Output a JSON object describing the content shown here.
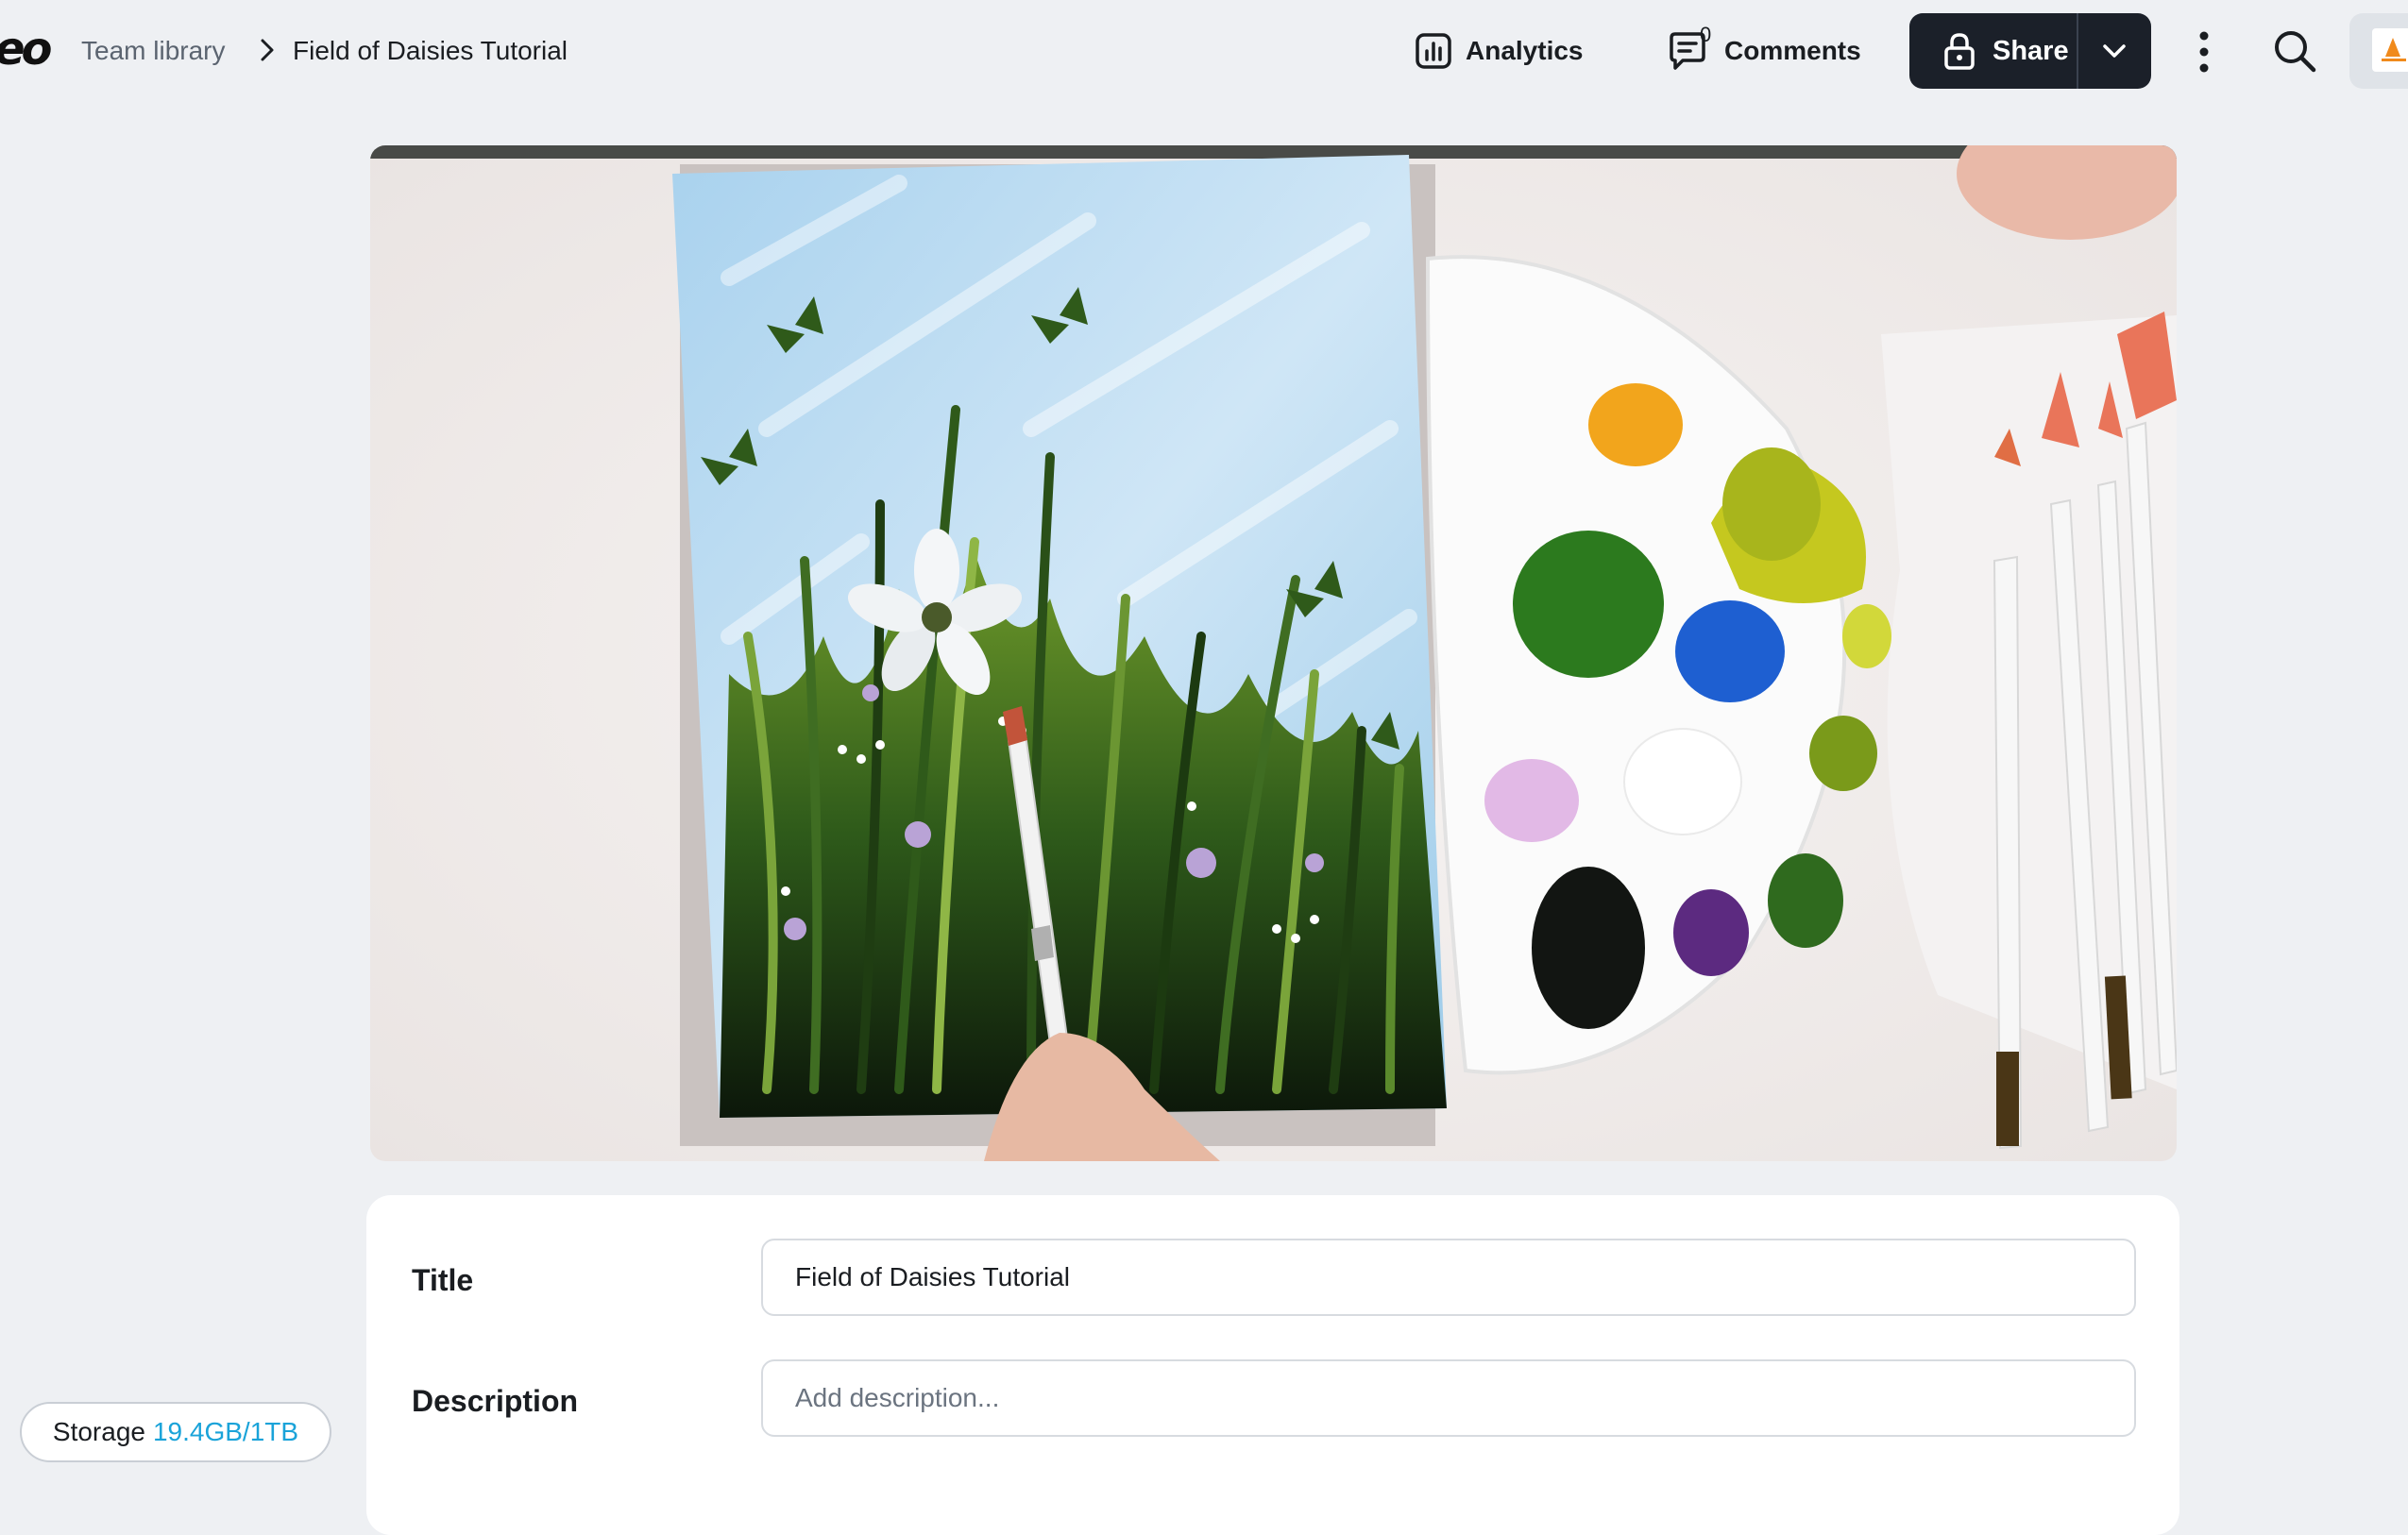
{
  "header": {
    "logo_text": "eo",
    "breadcrumb": {
      "parent": "Team library",
      "current": "Field of Daisies Tutorial"
    },
    "analytics_label": "Analytics",
    "comments_label": "Comments",
    "comments_count": "0",
    "share_label": "Share"
  },
  "video": {
    "subject": "painting-of-daisies-and-grass-with-palette-and-brushes"
  },
  "details": {
    "title_label": "Title",
    "title_value": "Field of Daisies Tutorial",
    "description_label": "Description",
    "description_placeholder": "Add description..."
  },
  "storage": {
    "label": "Storage",
    "value": "19.4GB/1TB",
    "value_color": "#1aa3d9"
  },
  "colors": {
    "background": "#eef0f3",
    "share_button": "#1b2029",
    "card": "#ffffff"
  }
}
